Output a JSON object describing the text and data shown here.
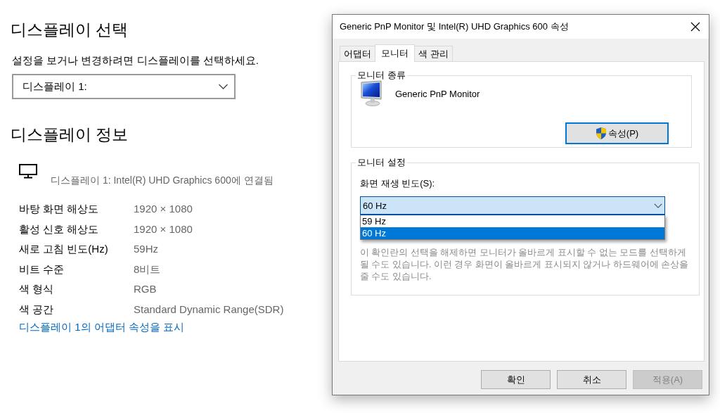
{
  "settings": {
    "heading": "디스플레이 선택",
    "instruction": "설정을 보거나 변경하려면 디스플레이를 선택하세요.",
    "display_select": {
      "value": "디스플레이 1:"
    },
    "info_heading": "디스플레이 정보",
    "connection": "디스플레이 1: Intel(R) UHD Graphics 600에 연결됨",
    "rows": [
      {
        "label": "바탕 화면 해상도",
        "value": "1920 × 1080"
      },
      {
        "label": "활성 신호 해상도",
        "value": "1920 × 1080"
      },
      {
        "label": "새로 고침 빈도(Hz)",
        "value": "59Hz"
      },
      {
        "label": "비트 수준",
        "value": "8비트"
      },
      {
        "label": "색 형식",
        "value": "RGB"
      },
      {
        "label": "색 공간",
        "value": "Standard Dynamic Range(SDR)"
      }
    ],
    "adapter_link": "디스플레이 1의 어댑터 속성을 표시"
  },
  "dialog": {
    "title": "Generic PnP Monitor 및 Intel(R) UHD Graphics 600 속성",
    "tabs": [
      {
        "label": "어댑터",
        "selected": false
      },
      {
        "label": "모니터",
        "selected": true
      },
      {
        "label": "색 관리",
        "selected": false
      }
    ],
    "monitor_type": {
      "legend": "모니터 종류",
      "name": "Generic PnP Monitor",
      "properties_button": "속성(P)"
    },
    "monitor_settings": {
      "legend": "모니터 설정",
      "refresh_label": "화면 재생 빈도(S):",
      "refresh_select": {
        "value": "60 Hz",
        "expanded": true,
        "options": [
          {
            "label": "59 Hz",
            "selected": false
          },
          {
            "label": "60 Hz",
            "selected": true
          }
        ]
      },
      "warning": "이 확인란의 선택을 해제하면 모니터가 올바르게 표시할 수 없는 모드를 선택하게 될 수도 있습니다. 이런 경우 화면이 올바르게 표시되지 않거나 하드웨어에 손상을 줄 수도 있습니다."
    },
    "buttons": [
      {
        "label": "확인",
        "disabled": false
      },
      {
        "label": "취소",
        "disabled": false
      },
      {
        "label": "적용(A)",
        "disabled": true
      }
    ]
  }
}
